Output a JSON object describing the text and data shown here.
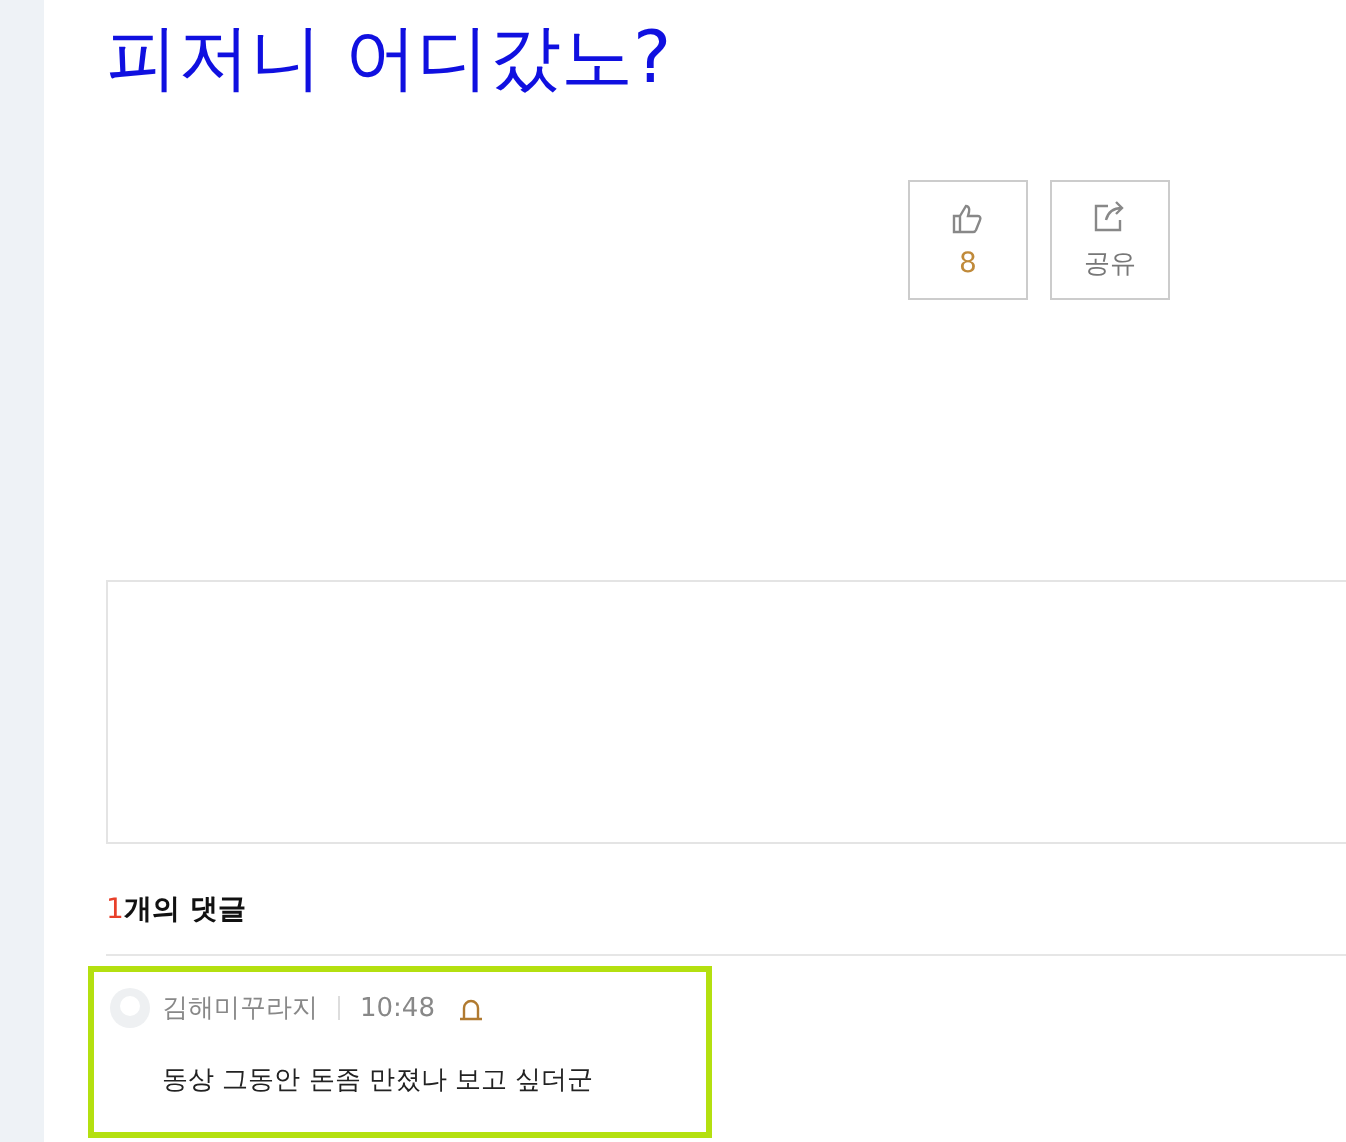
{
  "post": {
    "title": "피저니 어디갔노?"
  },
  "actions": [
    {
      "kind": "like",
      "label": "8"
    },
    {
      "kind": "share",
      "label": "공유"
    }
  ],
  "comments_header": {
    "count": "1",
    "label": "개의 댓글"
  },
  "comments": [
    {
      "author": "김해미꾸라지",
      "time": "10:48",
      "text": "동상 그동안 돈좀 만졌나 보고 싶더군",
      "highlighted": true
    }
  ]
}
